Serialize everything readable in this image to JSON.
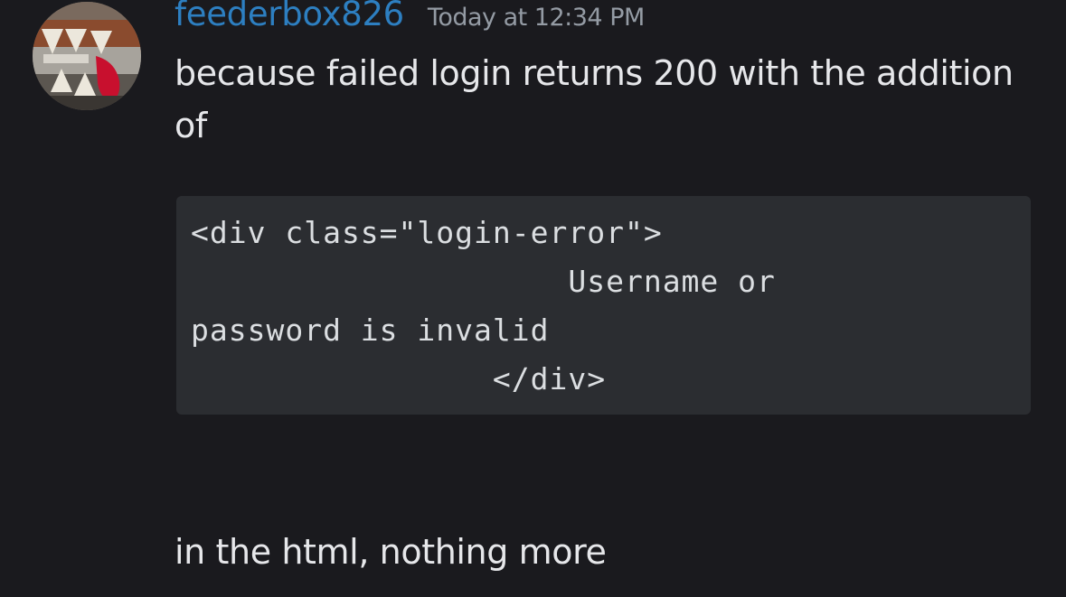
{
  "message": {
    "username": "feederbox826",
    "timestamp": "Today at 12:34 PM",
    "avatar_icon": "crochet-monster-avatar-icon",
    "text_before": "because failed login returns 200 with the addition of",
    "code": "<div class=\"login-error\">\n                    Username or\npassword is invalid\n                </div>",
    "text_after": "in the html, nothing more"
  },
  "colors": {
    "background": "#1a1a1e",
    "username": "#2d7fc1",
    "timestamp": "#949ba4",
    "text": "#e6e7ea",
    "codeblock_bg": "#2b2d31"
  }
}
